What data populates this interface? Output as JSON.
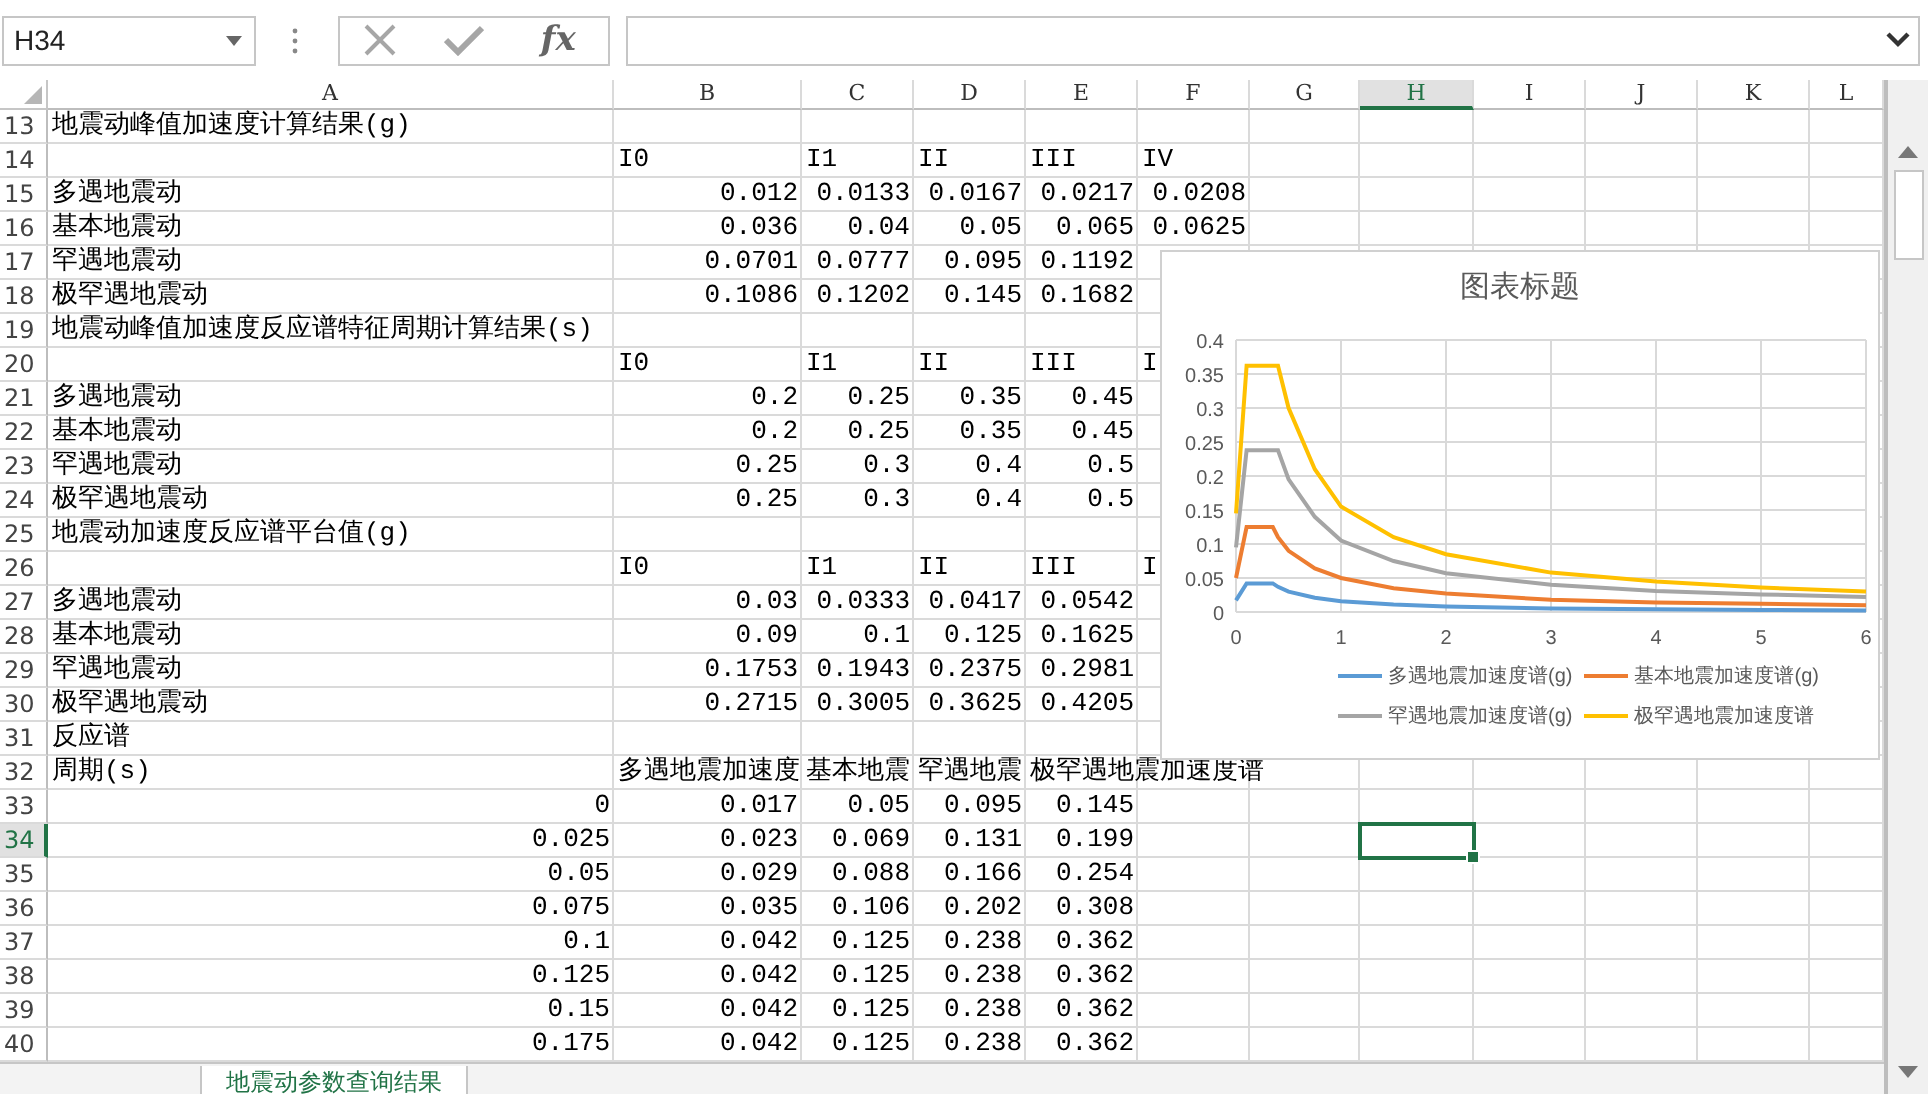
{
  "name_box": {
    "value": "H34"
  },
  "formula_bar": {
    "function_label": "fx"
  },
  "columns": [
    {
      "label": "A",
      "selected": false
    },
    {
      "label": "B",
      "selected": false
    },
    {
      "label": "C",
      "selected": false
    },
    {
      "label": "D",
      "selected": false
    },
    {
      "label": "E",
      "selected": false
    },
    {
      "label": "F",
      "selected": false
    },
    {
      "label": "G",
      "selected": false
    },
    {
      "label": "H",
      "selected": true
    },
    {
      "label": "I",
      "selected": false
    },
    {
      "label": "J",
      "selected": false
    },
    {
      "label": "K",
      "selected": false
    },
    {
      "label": "L",
      "selected": false
    }
  ],
  "rows": [
    {
      "number": "13",
      "selected": false,
      "kind": "header",
      "cells": {
        "A": "地震动峰值加速度计算结果(g)"
      }
    },
    {
      "number": "14",
      "selected": false,
      "kind": "header",
      "cells": {
        "B": "I0",
        "C": "I1",
        "D": "II",
        "E": "III",
        "F": "IV"
      }
    },
    {
      "number": "15",
      "selected": false,
      "kind": "data",
      "cells": {
        "A": "多遇地震动",
        "B": "0.012",
        "C": "0.0133",
        "D": "0.0167",
        "E": "0.0217",
        "F": "0.0208"
      }
    },
    {
      "number": "16",
      "selected": false,
      "kind": "data",
      "cells": {
        "A": "基本地震动",
        "B": "0.036",
        "C": "0.04",
        "D": "0.05",
        "E": "0.065",
        "F": "0.0625"
      }
    },
    {
      "number": "17",
      "selected": false,
      "kind": "data",
      "cells": {
        "A": "罕遇地震动",
        "B": "0.0701",
        "C": "0.0777",
        "D": "0.095",
        "E": "0.1192"
      }
    },
    {
      "number": "18",
      "selected": false,
      "kind": "data",
      "cells": {
        "A": "极罕遇地震动",
        "B": "0.1086",
        "C": "0.1202",
        "D": "0.145",
        "E": "0.1682"
      }
    },
    {
      "number": "19",
      "selected": false,
      "kind": "header",
      "cells": {
        "A": "地震动峰值加速度反应谱特征周期计算结果(s)"
      }
    },
    {
      "number": "20",
      "selected": false,
      "kind": "header",
      "cells": {
        "B": "I0",
        "C": "I1",
        "D": "II",
        "E": "III",
        "F": "I"
      }
    },
    {
      "number": "21",
      "selected": false,
      "kind": "data",
      "cells": {
        "A": "多遇地震动",
        "B": "0.2",
        "C": "0.25",
        "D": "0.35",
        "E": "0.45"
      }
    },
    {
      "number": "22",
      "selected": false,
      "kind": "data",
      "cells": {
        "A": "基本地震动",
        "B": "0.2",
        "C": "0.25",
        "D": "0.35",
        "E": "0.45"
      }
    },
    {
      "number": "23",
      "selected": false,
      "kind": "data",
      "cells": {
        "A": "罕遇地震动",
        "B": "0.25",
        "C": "0.3",
        "D": "0.4",
        "E": "0.5"
      }
    },
    {
      "number": "24",
      "selected": false,
      "kind": "data",
      "cells": {
        "A": "极罕遇地震动",
        "B": "0.25",
        "C": "0.3",
        "D": "0.4",
        "E": "0.5"
      }
    },
    {
      "number": "25",
      "selected": false,
      "kind": "header",
      "cells": {
        "A": "地震动加速度反应谱平台值(g)"
      }
    },
    {
      "number": "26",
      "selected": false,
      "kind": "header",
      "cells": {
        "B": "I0",
        "C": "I1",
        "D": "II",
        "E": "III",
        "F": "I"
      }
    },
    {
      "number": "27",
      "selected": false,
      "kind": "data",
      "cells": {
        "A": "多遇地震动",
        "B": "0.03",
        "C": "0.0333",
        "D": "0.0417",
        "E": "0.0542"
      }
    },
    {
      "number": "28",
      "selected": false,
      "kind": "data",
      "cells": {
        "A": "基本地震动",
        "B": "0.09",
        "C": "0.1",
        "D": "0.125",
        "E": "0.1625"
      }
    },
    {
      "number": "29",
      "selected": false,
      "kind": "data",
      "cells": {
        "A": "罕遇地震动",
        "B": "0.1753",
        "C": "0.1943",
        "D": "0.2375",
        "E": "0.2981"
      }
    },
    {
      "number": "30",
      "selected": false,
      "kind": "data",
      "cells": {
        "A": "极罕遇地震动",
        "B": "0.2715",
        "C": "0.3005",
        "D": "0.3625",
        "E": "0.4205"
      }
    },
    {
      "number": "31",
      "selected": false,
      "kind": "header",
      "cells": {
        "A": "反应谱"
      }
    },
    {
      "number": "32",
      "selected": false,
      "kind": "header",
      "cells": {
        "A": "周期(s)",
        "B": "多遇地震加速度",
        "C": "基本地震",
        "D": "罕遇地震",
        "E": "极罕遇地震加速度谱"
      }
    },
    {
      "number": "33",
      "selected": false,
      "kind": "series",
      "cells": {
        "A": "0",
        "B": "0.017",
        "C": "0.05",
        "D": "0.095",
        "E": "0.145"
      }
    },
    {
      "number": "34",
      "selected": true,
      "kind": "series",
      "cells": {
        "A": "0.025",
        "B": "0.023",
        "C": "0.069",
        "D": "0.131",
        "E": "0.199"
      }
    },
    {
      "number": "35",
      "selected": false,
      "kind": "series",
      "cells": {
        "A": "0.05",
        "B": "0.029",
        "C": "0.088",
        "D": "0.166",
        "E": "0.254"
      }
    },
    {
      "number": "36",
      "selected": false,
      "kind": "series",
      "cells": {
        "A": "0.075",
        "B": "0.035",
        "C": "0.106",
        "D": "0.202",
        "E": "0.308"
      }
    },
    {
      "number": "37",
      "selected": false,
      "kind": "series",
      "cells": {
        "A": "0.1",
        "B": "0.042",
        "C": "0.125",
        "D": "0.238",
        "E": "0.362"
      }
    },
    {
      "number": "38",
      "selected": false,
      "kind": "series",
      "cells": {
        "A": "0.125",
        "B": "0.042",
        "C": "0.125",
        "D": "0.238",
        "E": "0.362"
      }
    },
    {
      "number": "39",
      "selected": false,
      "kind": "series",
      "cells": {
        "A": "0.15",
        "B": "0.042",
        "C": "0.125",
        "D": "0.238",
        "E": "0.362"
      }
    },
    {
      "number": "40",
      "selected": false,
      "kind": "series",
      "cells": {
        "A": "0.175",
        "B": "0.042",
        "C": "0.125",
        "D": "0.238",
        "E": "0.362"
      }
    }
  ],
  "chart": {
    "chart_data": {
      "type": "line",
      "title": "图表标题",
      "x": [
        0,
        0.1,
        0.35,
        0.4,
        0.5,
        0.75,
        1,
        1.5,
        2,
        3,
        4,
        5,
        6
      ],
      "series": [
        {
          "name": "多遇地震加速度谱(g)",
          "color": "#5b9bd5",
          "values": [
            0.017,
            0.042,
            0.042,
            0.037,
            0.03,
            0.021,
            0.016,
            0.011,
            0.008,
            0.005,
            0.004,
            0.003,
            0.002
          ]
        },
        {
          "name": "基本地震加速度谱(g)",
          "color": "#ed7d31",
          "values": [
            0.05,
            0.125,
            0.125,
            0.11,
            0.09,
            0.064,
            0.05,
            0.035,
            0.027,
            0.018,
            0.014,
            0.012,
            0.01
          ]
        },
        {
          "name": "罕遇地震加速度谱(g)",
          "color": "#a5a5a5",
          "values": [
            0.095,
            0.238,
            0.238,
            0.238,
            0.195,
            0.14,
            0.105,
            0.075,
            0.057,
            0.04,
            0.031,
            0.026,
            0.022
          ]
        },
        {
          "name": "极罕遇地震加速度谱",
          "color": "#ffc000",
          "values": [
            0.145,
            0.362,
            0.362,
            0.362,
            0.3,
            0.21,
            0.155,
            0.11,
            0.085,
            0.058,
            0.045,
            0.036,
            0.03
          ]
        }
      ],
      "xlim": [
        0,
        6
      ],
      "ylim": [
        0,
        0.4
      ],
      "xticks": [
        {
          "value": 0,
          "label": "0"
        },
        {
          "value": 1,
          "label": "1"
        },
        {
          "value": 2,
          "label": "2"
        },
        {
          "value": 3,
          "label": "3"
        },
        {
          "value": 4,
          "label": "4"
        },
        {
          "value": 5,
          "label": "5"
        },
        {
          "value": 6,
          "label": "6"
        }
      ],
      "yticks": [
        {
          "value": 0,
          "label": "0"
        },
        {
          "value": 0.05,
          "label": "0.05"
        },
        {
          "value": 0.1,
          "label": "0.1"
        },
        {
          "value": 0.15,
          "label": "0.15"
        },
        {
          "value": 0.2,
          "label": "0.2"
        },
        {
          "value": 0.25,
          "label": "0.25"
        },
        {
          "value": 0.3,
          "label": "0.3"
        },
        {
          "value": 0.35,
          "label": "0.35"
        },
        {
          "value": 0.4,
          "label": "0.4"
        }
      ],
      "grid": true,
      "legend": true
    }
  },
  "sheet_tabs": [
    {
      "label": "地震动参数查询结果",
      "selected": true
    }
  ]
}
